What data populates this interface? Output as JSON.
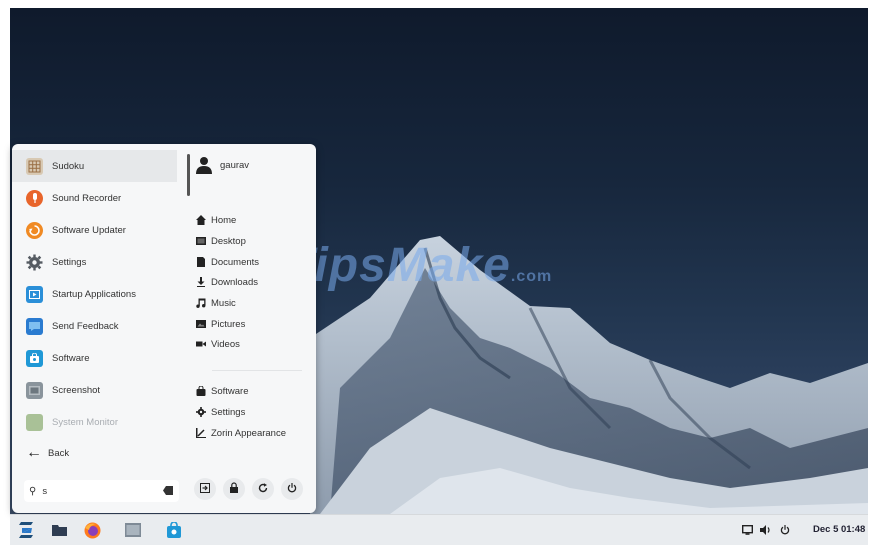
{
  "desktop": {
    "watermark": "TipsMake",
    "watermark_suffix": ".com"
  },
  "menu": {
    "apps": [
      {
        "label": "Sudoku",
        "icon": "sudoku-icon",
        "color": "#c9b59a",
        "selected": true
      },
      {
        "label": "Sound Recorder",
        "icon": "sound-recorder-icon",
        "color": "#e8652b"
      },
      {
        "label": "Software Updater",
        "icon": "software-updater-icon",
        "color": "#f08a24"
      },
      {
        "label": "Settings",
        "icon": "settings-gear-icon",
        "color": "#555b62"
      },
      {
        "label": "Startup Applications",
        "icon": "startup-applications-icon",
        "color": "#2a8fd8"
      },
      {
        "label": "Send Feedback",
        "icon": "send-feedback-icon",
        "color": "#2a7bd0"
      },
      {
        "label": "Software",
        "icon": "software-bag-icon",
        "color": "#1f98d6"
      },
      {
        "label": "Screenshot",
        "icon": "screenshot-icon",
        "color": "#7c8790"
      },
      {
        "label": "System Monitor",
        "icon": "system-monitor-icon",
        "color": "#8fae7a",
        "dim": true
      }
    ],
    "back_label": "Back",
    "search": {
      "value": "s",
      "placeholder": ""
    },
    "user_name": "gaurav",
    "places": [
      {
        "label": "Home",
        "icon": "home-icon"
      },
      {
        "label": "Desktop",
        "icon": "desktop-icon"
      },
      {
        "label": "Documents",
        "icon": "documents-icon"
      },
      {
        "label": "Downloads",
        "icon": "downloads-icon"
      },
      {
        "label": "Music",
        "icon": "music-icon"
      },
      {
        "label": "Pictures",
        "icon": "pictures-icon"
      },
      {
        "label": "Videos",
        "icon": "videos-icon"
      }
    ],
    "system": [
      {
        "label": "Software",
        "icon": "software-icon"
      },
      {
        "label": "Settings",
        "icon": "settings-icon"
      },
      {
        "label": "Zorin Appearance",
        "icon": "zorin-appearance-icon"
      }
    ],
    "buttons": [
      "logout-icon",
      "lock-icon",
      "restart-icon",
      "power-icon"
    ]
  },
  "panel": {
    "launchers": [
      "zorin-menu-icon",
      "files-icon",
      "firefox-icon",
      "file-manager-icon",
      "software-store-icon"
    ],
    "clock": "Dec 5  01:48"
  },
  "colors": {
    "accent": "#2a8fd8",
    "panel": "#e9ecef",
    "menu": "#f6f7f8"
  }
}
